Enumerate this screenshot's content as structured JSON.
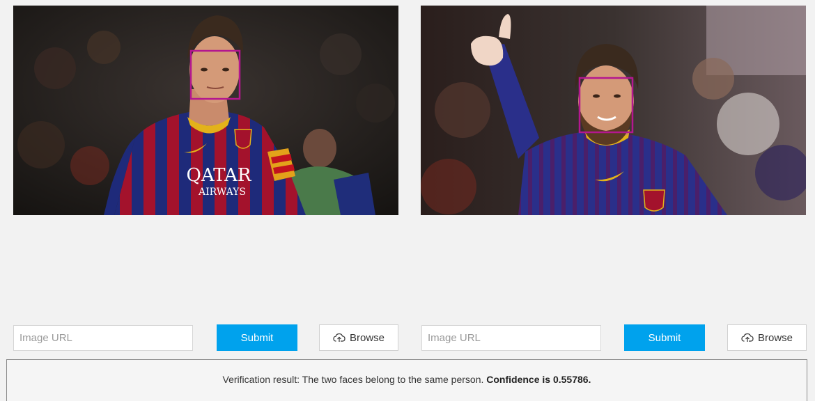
{
  "colors": {
    "accent": "#00a2ed",
    "face_box": "#b4178f",
    "page_bg": "#f2f2f2"
  },
  "images": [
    {
      "description": "Football player in red and blue striped jersey with a face detection box",
      "face_detected": true
    },
    {
      "description": "Football player in blue jersey giving a thumbs up with a face detection box",
      "face_detected": true
    }
  ],
  "panels": [
    {
      "url_placeholder": "Image URL",
      "url_value": "",
      "submit_label": "Submit",
      "browse_label": "Browse",
      "browse_icon": "cloud-upload-icon"
    },
    {
      "url_placeholder": "Image URL",
      "url_value": "",
      "submit_label": "Submit",
      "browse_label": "Browse",
      "browse_icon": "cloud-upload-icon"
    }
  ],
  "result": {
    "prefix": "Verification result: The two faces belong to the same person. ",
    "confidence": "Confidence is 0.55786."
  }
}
